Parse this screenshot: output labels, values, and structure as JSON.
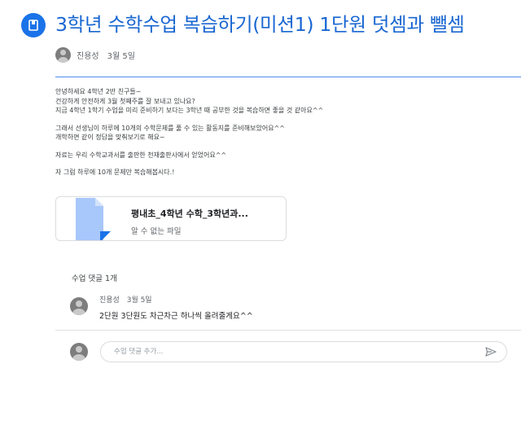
{
  "post": {
    "title": "3학년 수학수업 복습하기(미션1) 1단원 덧셈과 뺄셈",
    "author": "진용성",
    "date": "3월 5일",
    "body": [
      "안녕하세요 4학년 2반 친구들~",
      "건강하게 안전하게 3월 첫째주를 잘 보내고 있나요?",
      "지금 4학년 1학기 수업을 미리 준비하기 보다는 3학년 때 공부한 것을 복습하면 좋을 것 같아요^^",
      "그래서 선생님이 하루에 10개의 수학문제를 풀 수 있는 활동지를 준비해보았어요^^",
      "개학하면 같이 정답을 맞춰보기로 해요~",
      "자료는 우리 수학교과서를 출판한 천재출판사에서 얻었어요^^",
      "자 그럼 하루에 10개 문제만 복습해봅시다.!"
    ]
  },
  "attachment": {
    "name": "평내초_4학년 수학_3학년과...",
    "subtitle": "알 수 없는 파일"
  },
  "comments": {
    "count_label": "수업 댓글 1개",
    "items": [
      {
        "author": "진용성",
        "date": "3월 5일",
        "text": "2단원 3단원도 차근차근 하나씩 올려줄게요^^"
      }
    ],
    "reply_placeholder": "수업 댓글 추가..."
  },
  "icons": {
    "header": "assignment-book-icon",
    "file": "file-icon",
    "send": "send-icon"
  },
  "colors": {
    "accent": "#1a73e8",
    "title": "#1967d2",
    "file_thumb": "#a8c7fa"
  }
}
